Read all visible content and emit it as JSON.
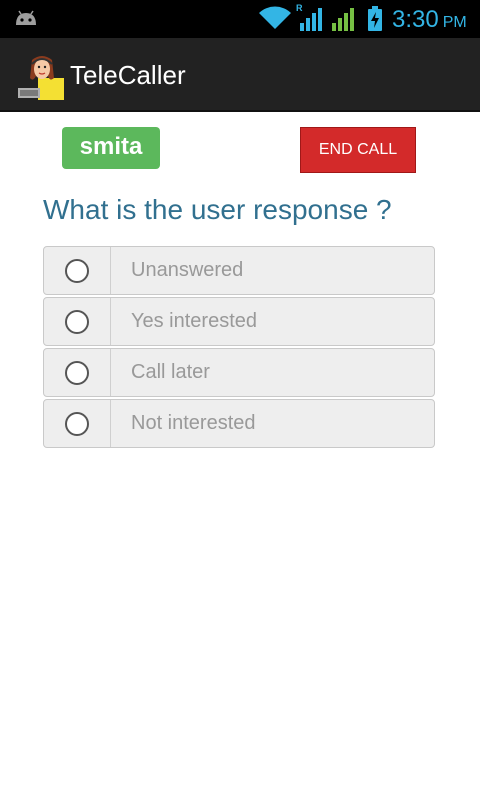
{
  "status_bar": {
    "icons": [
      "android-icon",
      "wifi-icon",
      "signal-icon",
      "signal-icon",
      "battery-charging-icon"
    ],
    "roaming_label": "R",
    "time": "3:30",
    "ampm": "PM",
    "accent_color": "#33b5e5"
  },
  "action_bar": {
    "icon": "telecaller-avatar-icon",
    "title": "TeleCaller"
  },
  "user": {
    "name": "smita"
  },
  "end_call_label": "END CALL",
  "question": "What is the user response ?",
  "options": [
    {
      "label": "Unanswered",
      "selected": false
    },
    {
      "label": "Yes interested",
      "selected": false
    },
    {
      "label": "Call later",
      "selected": false
    },
    {
      "label": "Not interested",
      "selected": false
    }
  ],
  "colors": {
    "name_badge": "#5cb85c",
    "end_call": "#d32a2a",
    "question_text": "#31708f"
  }
}
